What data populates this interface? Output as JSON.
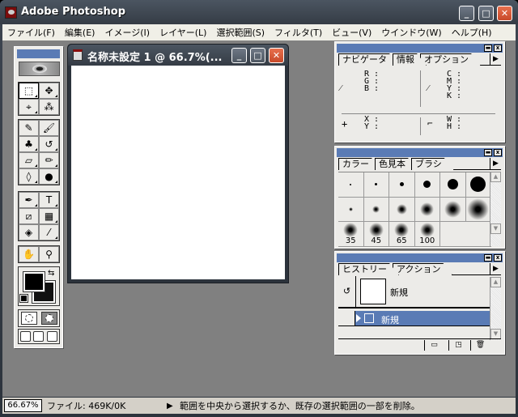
{
  "app": {
    "title": "Adobe Photoshop",
    "controls": {
      "minimize": "_",
      "maximize": "□",
      "close": "✕"
    }
  },
  "menubar": [
    "ファイル(F)",
    "編集(E)",
    "イメージ(I)",
    "レイヤー(L)",
    "選択範囲(S)",
    "フィルタ(T)",
    "ビュー(V)",
    "ウインドウ(W)",
    "ヘルプ(H)"
  ],
  "toolbox": {
    "tools": [
      {
        "name": "marquee-tool",
        "glyph": "⬚"
      },
      {
        "name": "move-tool",
        "glyph": "✥"
      },
      {
        "name": "lasso-tool",
        "glyph": "⌖"
      },
      {
        "name": "magic-wand-tool",
        "glyph": "⁂"
      },
      {
        "name": "airbrush-tool",
        "glyph": "✎"
      },
      {
        "name": "paintbrush-tool",
        "glyph": "🖌"
      },
      {
        "name": "rubber-stamp-tool",
        "glyph": "♣"
      },
      {
        "name": "history-brush-tool",
        "glyph": "↺"
      },
      {
        "name": "eraser-tool",
        "glyph": "▱"
      },
      {
        "name": "pencil-tool",
        "glyph": "✏"
      },
      {
        "name": "blur-tool",
        "glyph": "◊"
      },
      {
        "name": "burn-tool",
        "glyph": "●"
      },
      {
        "name": "pen-tool",
        "glyph": "✒"
      },
      {
        "name": "type-tool",
        "glyph": "T"
      },
      {
        "name": "measure-tool",
        "glyph": "⧄"
      },
      {
        "name": "gradient-tool",
        "glyph": "▦"
      },
      {
        "name": "paint-bucket-tool",
        "glyph": "◈"
      },
      {
        "name": "eyedropper-tool",
        "glyph": "⁄"
      },
      {
        "name": "hand-tool",
        "glyph": "✋"
      },
      {
        "name": "zoom-tool",
        "glyph": "⚲"
      }
    ],
    "swap_glyph": "⇆",
    "foreground_color": "#000000",
    "background_color": "#111111"
  },
  "document": {
    "title": "名称未設定 1 @ 66.7%(...",
    "controls": {
      "minimize": "_",
      "maximize": "□",
      "close": "✕"
    }
  },
  "info_palette": {
    "tabs": [
      "ナビゲータ",
      "情報",
      "オプション"
    ],
    "active_tab": "情報",
    "rgb_labels": "R :\nG :\nB :",
    "cmyk_labels": "C :\nM :\nY :\nK :",
    "xy_labels": "X :\nY :",
    "wh_labels": "W :\nH :",
    "menu_arrow": "▶"
  },
  "brushes_palette": {
    "tabs": [
      "カラー",
      "色見本",
      "ブラシ"
    ],
    "active_tab": "ブラシ",
    "hard_brushes": [
      1,
      3,
      5,
      9,
      13,
      19
    ],
    "soft_brushes": [
      5,
      9,
      13,
      17,
      21,
      27
    ],
    "large_brushes": [
      "35",
      "45",
      "65",
      "100"
    ],
    "menu_arrow": "▶"
  },
  "history_palette": {
    "tabs": [
      "ヒストリー",
      "アクション"
    ],
    "active_tab": "ヒストリー",
    "snapshot_label": "新規",
    "states": [
      "新規"
    ],
    "menu_arrow": "▶"
  },
  "statusbar": {
    "zoom": "66.67%",
    "file_info": "ファイル: 469K/0K",
    "arrow": "▶",
    "hint": "範囲を中央から選択するか、既存の選択範囲の一部を削除。"
  },
  "colors": {
    "accent": "#5a7bb5",
    "workspace": "#808080",
    "titlebar": "#3d4550",
    "close_button": "#d85a38"
  }
}
